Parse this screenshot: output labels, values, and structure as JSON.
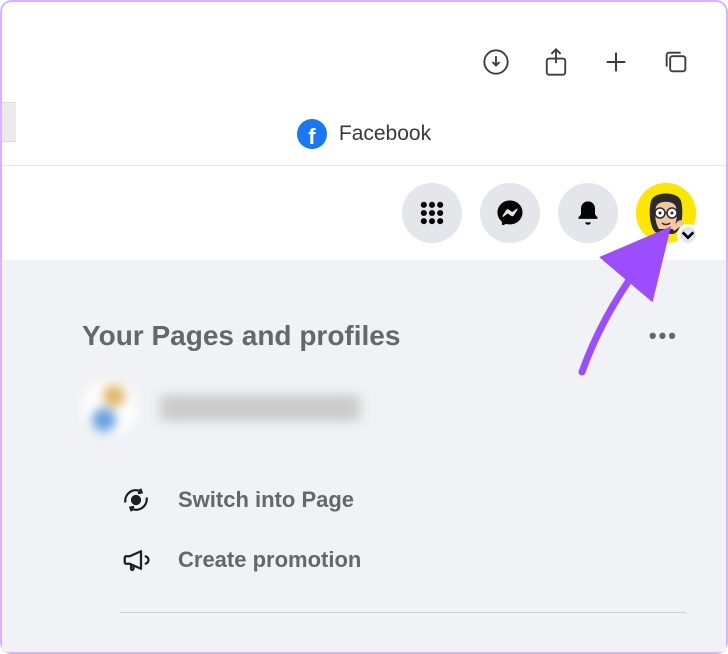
{
  "browser": {
    "tab_title": "Facebook"
  },
  "header": {
    "icons": {
      "menu": "menu-grid",
      "messenger": "messenger",
      "notifications": "bell",
      "avatar": "profile-avatar"
    }
  },
  "section": {
    "title": "Your Pages and profiles",
    "actions": {
      "switch": "Switch into Page",
      "promote": "Create promotion"
    }
  }
}
